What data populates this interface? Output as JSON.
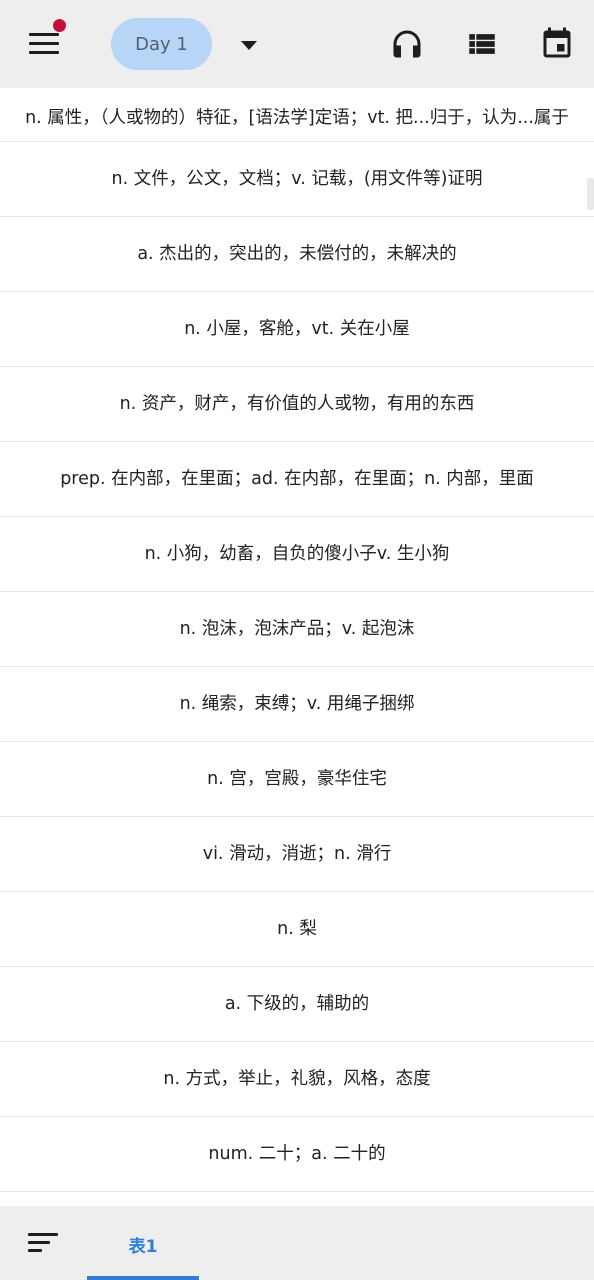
{
  "header": {
    "day_label": "Day 1",
    "icons": [
      "menu-icon",
      "notification-dot",
      "dropdown-arrow-icon",
      "headphones-icon",
      "list-view-icon",
      "calendar-icon"
    ],
    "notification_color": "#c2123b",
    "pill_color": "#b6d5f7"
  },
  "list": {
    "items": [
      "n. 属性，（人或物的）特征，[语法学]定语；vt. 把...归于，认为...属于",
      "n. 文件，公文，文档；v. 记载，(用文件等)证明",
      "a. 杰出的，突出的，未偿付的，未解决的",
      "n. 小屋，客舱，vt. 关在小屋",
      "n. 资产，财产，有价值的人或物，有用的东西",
      "prep. 在内部，在里面；ad. 在内部，在里面；n. 内部，里面",
      "n. 小狗，幼畜，自负的傻小子v. 生小狗",
      "n. 泡沫，泡沫产品；v. 起泡沫",
      "n. 绳索，束缚；v. 用绳子捆绑",
      "n. 宫，宫殿，豪华住宅",
      "vi. 滑动，消逝；n. 滑行",
      "n. 梨",
      "a. 下级的，辅助的",
      "n. 方式，举止，礼貌，风格，态度",
      "num. 二十；a. 二十的"
    ]
  },
  "footer": {
    "tab_label": "表1",
    "accent_color": "#2f7fd6",
    "icons": [
      "sort-icon"
    ]
  }
}
